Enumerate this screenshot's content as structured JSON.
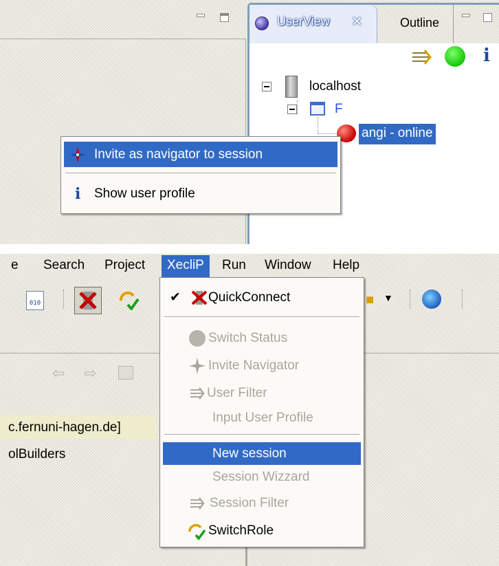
{
  "views": {
    "active_tab": "UserView",
    "other_tab": "Outline"
  },
  "tree": {
    "host": "localhost",
    "folder": "F",
    "user": "angi - online"
  },
  "context_menu": {
    "items": [
      {
        "label": "Invite as navigator to session",
        "icon": "navigator-compass-icon",
        "selected": true
      },
      {
        "label": "Show user profile",
        "icon": "info-icon",
        "selected": false
      }
    ]
  },
  "menubar": {
    "items": [
      "e",
      "Search",
      "Project",
      "XecliP",
      "Run",
      "Window",
      "Help"
    ],
    "active": "XecliP"
  },
  "xeclip_menu": {
    "items": [
      {
        "label": "QuickConnect",
        "enabled": true,
        "checked": true,
        "icon": "quickconnect-icon"
      },
      {
        "label": "Switch Status",
        "enabled": false,
        "icon": "status-dot-icon"
      },
      {
        "label": "Invite Navigator",
        "enabled": false,
        "icon": "navigator-compass-icon"
      },
      {
        "label": "User Filter",
        "enabled": false,
        "icon": "filter-arrows-icon"
      },
      {
        "label": "Input User Profile",
        "enabled": false,
        "icon": ""
      },
      {
        "label": "New session",
        "enabled": true,
        "selected": true,
        "icon": ""
      },
      {
        "label": "Session Wizzard",
        "enabled": false,
        "icon": ""
      },
      {
        "label": "Session Filter",
        "enabled": false,
        "icon": "filter-arrows-icon"
      },
      {
        "label": "SwitchRole",
        "enabled": true,
        "icon": "switch-role-icon"
      }
    ]
  },
  "editor": {
    "line1": "c.fernuni-hagen.de]",
    "line2": "olBuilders"
  },
  "colors": {
    "selection": "#316ac5",
    "background": "#e9e7dc",
    "disabled_text": "#a7a69e",
    "panel_border": "#7f9db9"
  }
}
